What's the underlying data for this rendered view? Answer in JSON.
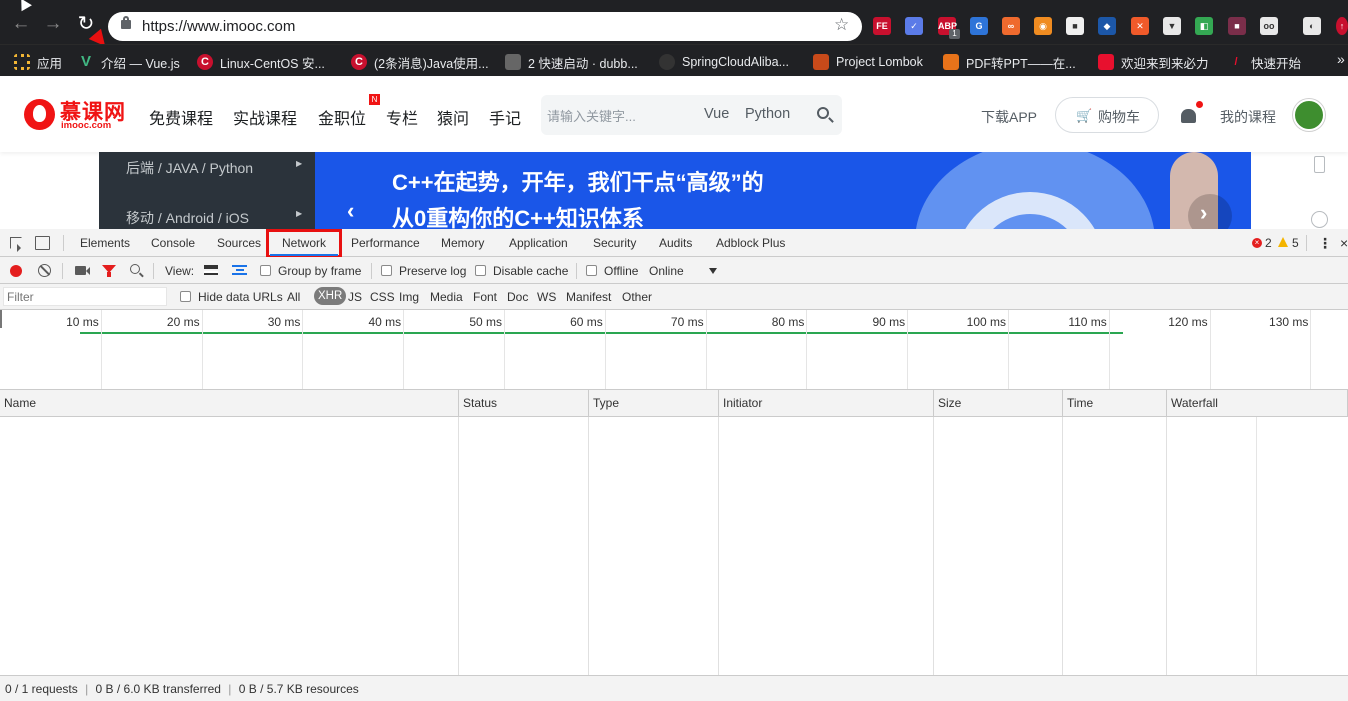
{
  "browser": {
    "url": "https://www.imooc.com",
    "extensions": [
      "FE",
      "✓",
      "ABP",
      "G",
      "∞",
      "◉",
      "■",
      "◆",
      "✕",
      "▼",
      "◧",
      "■",
      "oo",
      "◐",
      "↑"
    ],
    "ext_badge": "1",
    "bookmarks": [
      {
        "label": "应用",
        "icon": "apps-grid-icon"
      },
      {
        "label": "介绍 — Vue.js",
        "icon": "vue-icon"
      },
      {
        "label": "Linux-CentOS 安...",
        "icon": "csdn-icon"
      },
      {
        "label": "(2条消息)Java使用...",
        "icon": "csdn-icon"
      },
      {
        "label": "2 快速启动 · dubb...",
        "icon": "book-icon"
      },
      {
        "label": "SpringCloudAliba...",
        "icon": "github-icon"
      },
      {
        "label": "Project Lombok",
        "icon": "lombok-icon"
      },
      {
        "label": "PDF转PPT——在...",
        "icon": "docin-icon"
      },
      {
        "label": "欢迎来到来必力",
        "icon": "livere-icon"
      },
      {
        "label": "快速开始",
        "icon": "pen-icon"
      }
    ],
    "more": "»"
  },
  "site": {
    "logo_cn": "慕课网",
    "logo_en": "imooc.com",
    "nav": [
      "免费课程",
      "实战课程",
      "金职位",
      "专栏",
      "猿问",
      "手记"
    ],
    "new_badge": "N",
    "search_placeholder": "请输入关键字...",
    "search_tags": [
      "Vue",
      "Python"
    ],
    "download_app": "下载APP",
    "cart": "购物车",
    "my_courses": "我的课程",
    "colors": {
      "brand": "#f01414",
      "banner": "#1a56e8"
    }
  },
  "banner": {
    "categories": [
      "后端 / JAVA / Python",
      "移动 / Android / iOS"
    ],
    "line1": "C++在起势，开年，我们干点“高级”的",
    "line2": "从0重构你的C++知识体系"
  },
  "devtools": {
    "tabs": [
      "Elements",
      "Console",
      "Sources",
      "Network",
      "Performance",
      "Memory",
      "Application",
      "Security",
      "Audits",
      "Adblock Plus"
    ],
    "active_tab": "Network",
    "errors": "2",
    "warnings": "5",
    "toolbar": {
      "view_label": "View:",
      "group_by_frame": "Group by frame",
      "preserve_log": "Preserve log",
      "disable_cache": "Disable cache",
      "offline": "Offline",
      "throttle": "Online"
    },
    "filter": {
      "placeholder": "Filter",
      "hide_data_urls": "Hide data URLs",
      "types": [
        "All",
        "XHR",
        "JS",
        "CSS",
        "Img",
        "Media",
        "Font",
        "Doc",
        "WS",
        "Manifest",
        "Other"
      ],
      "active_type": "XHR"
    },
    "timeline_ticks": [
      "10 ms",
      "20 ms",
      "30 ms",
      "40 ms",
      "50 ms",
      "60 ms",
      "70 ms",
      "80 ms",
      "90 ms",
      "100 ms",
      "110 ms",
      "120 ms",
      "130 ms"
    ],
    "columns": [
      "Name",
      "Status",
      "Type",
      "Initiator",
      "Size",
      "Time",
      "Waterfall"
    ],
    "status": {
      "requests": "0 / 1 requests",
      "transferred": "0 B / 6.0 KB transferred",
      "resources": "0 B / 5.7 KB resources"
    }
  }
}
